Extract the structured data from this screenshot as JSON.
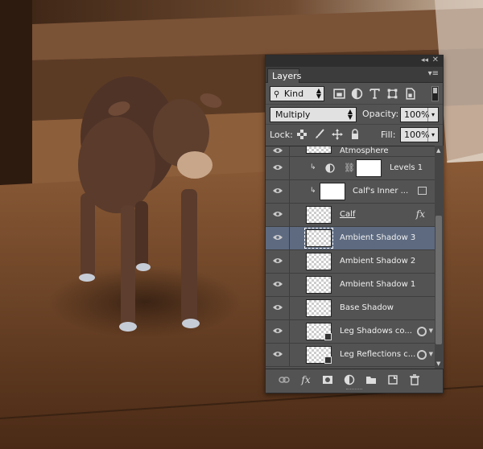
{
  "panel": {
    "tab_label": "Layers",
    "collapse_glyph": "◂◂",
    "close_glyph": "✕",
    "menu_glyph": "▾≡"
  },
  "filter": {
    "kind_label": "Kind",
    "icons": [
      "image-filter-icon",
      "adjustment-filter-icon",
      "type-filter-icon",
      "shape-filter-icon",
      "smart-object-filter-icon"
    ]
  },
  "blend": {
    "mode": "Multiply",
    "opacity_label": "Opacity:",
    "opacity_value": "100%",
    "lock_label": "Lock:",
    "fill_label": "Fill:",
    "fill_value": "100%"
  },
  "layers": [
    {
      "name": "Atmosphere",
      "thumb": "checker",
      "selected": false
    },
    {
      "name": "Levels 1",
      "thumb": "white",
      "selected": false
    },
    {
      "name": "Calf's Inner ...",
      "thumb": "white",
      "selected": false
    },
    {
      "name": "Calf",
      "thumb": "checker",
      "selected": false
    },
    {
      "name": "Ambient Shadow 3",
      "thumb": "checker",
      "selected": true
    },
    {
      "name": "Ambient Shadow 2",
      "thumb": "checker",
      "selected": false
    },
    {
      "name": "Ambient Shadow 1",
      "thumb": "checker",
      "selected": false
    },
    {
      "name": "Base Shadow",
      "thumb": "checker",
      "selected": false
    },
    {
      "name": "Leg Shadows co...",
      "thumb": "checker",
      "selected": false
    },
    {
      "name": "Leg Reflections c...",
      "thumb": "checker",
      "selected": false
    }
  ],
  "glyphs": {
    "fx": "fx",
    "clip_arrow": "↳",
    "chain": "⛓"
  },
  "colors": {
    "panel_bg": "#535353",
    "selected_row": "#5d6a80"
  }
}
